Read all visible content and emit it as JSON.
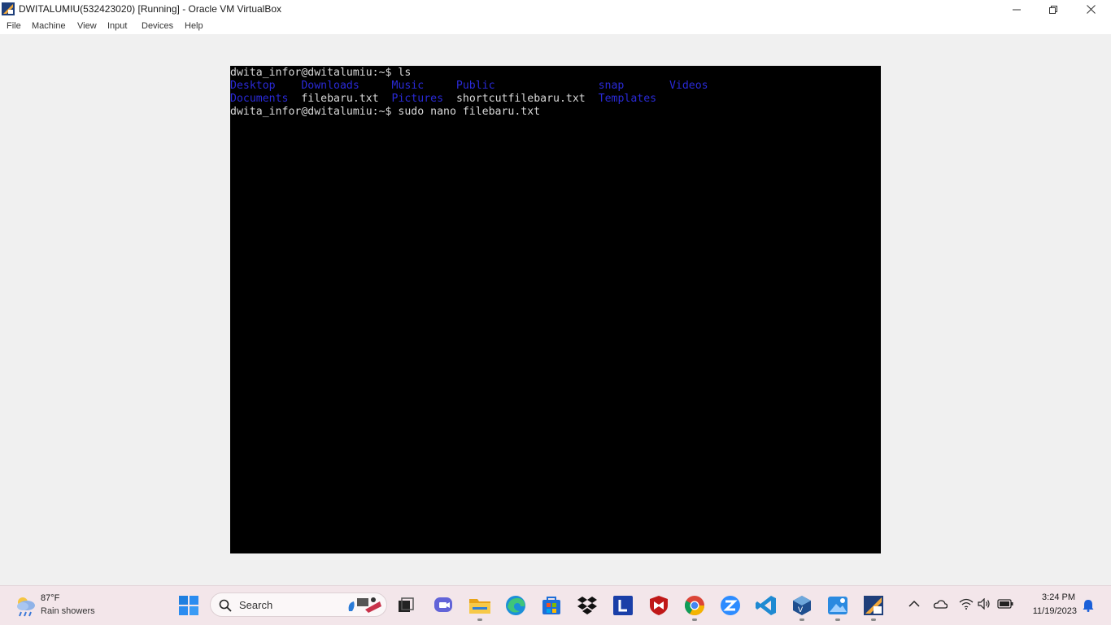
{
  "window": {
    "title": "DWITALUMIU(532423020) [Running] - Oracle VM VirtualBox"
  },
  "menu": [
    "File",
    "Machine",
    "View",
    "Input",
    "Devices",
    "Help"
  ],
  "terminal": {
    "prompt1": "dwita_infor@dwitalumiu:~$ ls",
    "row1": {
      "Desktop": "Desktop",
      "Downloads": "Downloads",
      "Music": "Music",
      "Public": "Public",
      "snap": "snap",
      "Videos": "Videos"
    },
    "row2": {
      "Documents": "Documents",
      "filebaru": "filebaru.txt",
      "Pictures": "Pictures",
      "shortcut": "shortcutfilebaru.txt",
      "Templates": "Templates"
    },
    "prompt2": "dwita_infor@dwitalumiu:~$ sudo nano filebaru.txt"
  },
  "taskbar": {
    "weather_temp": "87°F",
    "weather_desc": "Rain showers",
    "search_label": "Search",
    "clock_time": "3:24 PM",
    "clock_date": "11/19/2023",
    "pinned_icons": [
      "windows-start-icon",
      "search-icon",
      "task-view-icon",
      "teams-chat-icon",
      "file-explorer-icon",
      "edge-icon",
      "microsoft-store-icon",
      "dropbox-icon",
      "l-app-icon",
      "mcafee-icon",
      "chrome-icon",
      "zoom-icon",
      "vscode-icon",
      "virtualbox-icon",
      "paint-icon",
      "virtualbox-vm-icon"
    ],
    "tray_icons": [
      "chevron-up-icon",
      "onedrive-icon",
      "wifi-icon",
      "volume-icon",
      "battery-icon",
      "notification-bell-icon"
    ]
  },
  "colors": {
    "terminal_bg": "#000000",
    "terminal_fg": "#d9d9d9",
    "directory": "#2a2ad8",
    "taskbar_bg": "#f3e6ea"
  }
}
